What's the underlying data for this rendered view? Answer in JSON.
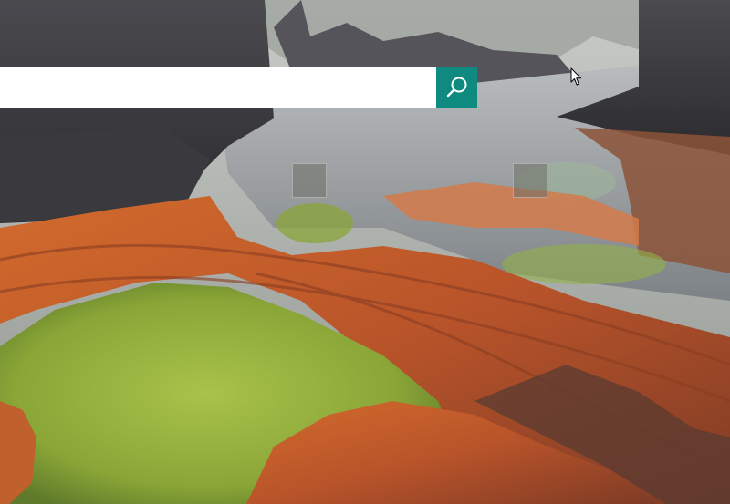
{
  "search": {
    "value": "",
    "placeholder": "",
    "button_icon": "search-icon",
    "button_color": "#0f8a80"
  },
  "wallpaper": {
    "description_icon": "landscape-photo"
  },
  "tiles": [
    {
      "name": "quick-link-tile-1"
    },
    {
      "name": "quick-link-tile-2"
    }
  ],
  "cursor": {
    "icon": "mouse-pointer-icon"
  },
  "colors": {
    "accent": "#0f8a80",
    "moss": "#8fae3a",
    "rock_orange": "#c8622a",
    "water": "#8a8e90",
    "dark_rock": "#3c3c40"
  }
}
